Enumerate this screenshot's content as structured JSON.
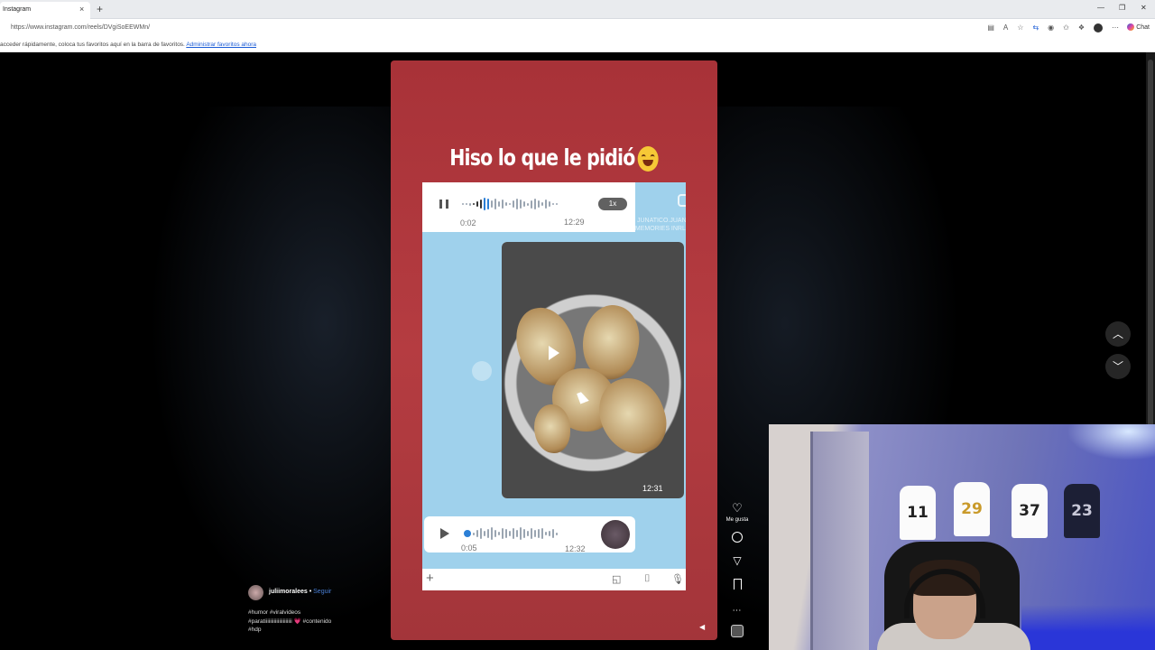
{
  "browser": {
    "tab_title": "Instagram",
    "tab_close": "×",
    "new_tab": "+",
    "url": "https://www.instagram.com/reels/DVgiSoEEWMn/",
    "chat_label": "Chat",
    "window_controls": [
      "—",
      "❐",
      "✕"
    ],
    "favorites_bar": {
      "text": "acceder rápidamente, coloca tus favoritos aquí en la barra de favoritos.",
      "link": "Administrar favoritos ahora"
    }
  },
  "reel": {
    "caption_overlay": "Hiso lo que le pidió",
    "voice_note_1": {
      "elapsed": "0:02",
      "sent_time": "12:29",
      "speed": "1x"
    },
    "watermark": "JUNATICO.JUANXX\nMEMORIES INRLND",
    "video_time": "12:31",
    "voice_note_2": {
      "elapsed": "0:05",
      "sent_time": "12:32"
    }
  },
  "actions": {
    "like_label": "Me gusta",
    "icons": [
      "heart-icon",
      "comment-icon",
      "share-icon",
      "bookmark-icon",
      "more-icon",
      "audio-icon"
    ]
  },
  "author": {
    "username": "juliimoralees",
    "follow_label": "Seguir",
    "separator": " • ",
    "caption_line1": "#humor #viralvideos",
    "caption_line2": "#paratiiiiiiiiiiiiiiiiiiiii 💗 #contenido",
    "caption_line3": "#hdp"
  },
  "webcam": {
    "jerseys": [
      "11",
      "29",
      "37",
      "23"
    ]
  },
  "colors": {
    "reel_bg": "#b53c41",
    "link_blue": "#1a5bd6",
    "follow_blue": "#4a7fd6"
  }
}
